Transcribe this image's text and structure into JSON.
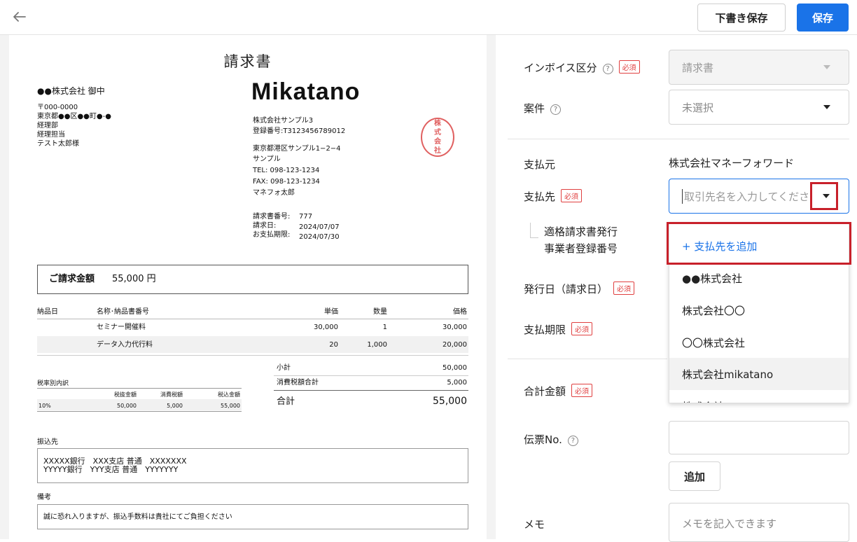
{
  "topbar": {
    "draft_label": "下書き保存",
    "save_label": "保存"
  },
  "preview": {
    "title": "請求書",
    "recipient": {
      "name": "●●株式会社 御中",
      "postal": "〒000-0000",
      "address": "東京都●●区●●町●-●",
      "dept": "経理部",
      "role": "経理担当",
      "person": "テスト太郎様"
    },
    "logo_text": "Mikatano",
    "issuer": {
      "company": "株式会社サンプル3",
      "reg_no": "登録番号:T3123456789012",
      "address1": "東京都港区サンプル1−2−4",
      "address2": "サンプル",
      "tel": "TEL: 098-123-1234",
      "fax": "FAX: 098-123-1234",
      "person": "マネフォ太郎"
    },
    "seal_text": [
      "株",
      "式",
      "会",
      "社"
    ],
    "invoice_no_label": "請求書番号:",
    "invoice_no": "777",
    "date_label": "請求日:",
    "date": "2024/07/07",
    "due_label": "お支払期限:",
    "due": "2024/07/30",
    "amount_label": "ご請求金額",
    "amount_value": "55,000 円",
    "items_header": [
      "納品日",
      "名称･納品書番号",
      "単価",
      "数量",
      "価格"
    ],
    "items": [
      {
        "name": "セミナー開催料",
        "unit": "30,000",
        "qty": "1",
        "price": "30,000"
      },
      {
        "name": "データ入力代行料",
        "unit": "20",
        "qty": "1,000",
        "price": "20,000"
      }
    ],
    "subtotal_label": "小計",
    "subtotal": "50,000",
    "tax_total_label": "消費税額合計",
    "tax_total": "5,000",
    "total_label": "合計",
    "total": "55,000",
    "tax_breakdown_label": "税率別内訳",
    "tax_header": [
      "税抜金額",
      "消費税額",
      "税込金額"
    ],
    "tax_row": {
      "rate": "10%",
      "net": "50,000",
      "tax": "5,000",
      "gross": "55,000"
    },
    "bank_label": "振込先",
    "bank_line1": "XXXXX銀行　XXX支店 普通　XXXXXXX",
    "bank_line2": "YYYYY銀行　YYY支店 普通　YYYYYYY",
    "note_label": "備考",
    "note": "誠に恐れ入りますが、振込手数料は貴社にてご負担ください"
  },
  "form": {
    "invoice_type_label": "インボイス区分",
    "invoice_type_value": "請求書",
    "required": "必須",
    "project_label": "案件",
    "project_value": "未選択",
    "payer_label": "支払元",
    "payer_value": "株式会社マネーフォワード",
    "payee_label": "支払先",
    "payee_placeholder": "取引先名を入力してください",
    "reg_no_label_1": "適格請求書発行",
    "reg_no_label_2": "事業者登録番号",
    "issue_date_label": "発行日（請求日）",
    "due_label": "支払期限",
    "total_label": "合計金額",
    "slip_label": "伝票No.",
    "add_label": "追加",
    "memo_label": "メモ",
    "memo_placeholder": "メモを記入できます",
    "help": "?"
  },
  "dropdown": {
    "add_label": "+ 支払先を追加",
    "options": [
      "●●株式会社",
      "株式会社〇〇",
      "〇〇株式会社",
      "株式会社mikatano",
      "株式会社○○"
    ]
  },
  "colors": {
    "primary": "#1a73e8",
    "required": "#e04040",
    "highlight": "#c8202a"
  }
}
